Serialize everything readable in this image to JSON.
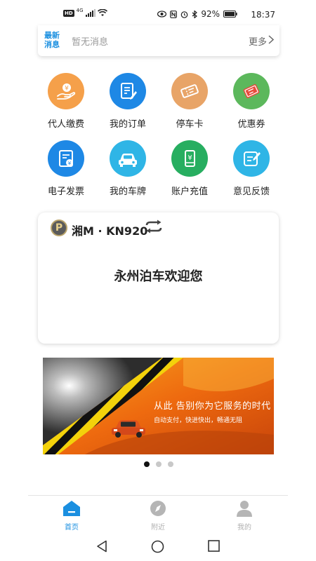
{
  "status_bar": {
    "network": "4G",
    "hd": "HD",
    "battery": "92%",
    "time": "18:37"
  },
  "news": {
    "tag": "最新消息",
    "message": "暂无消息",
    "more": "更多"
  },
  "grid": {
    "items": [
      {
        "label": "代人缴费",
        "icon": "hand-coin-icon",
        "color": "#f5a04a"
      },
      {
        "label": "我的订单",
        "icon": "order-doc-icon",
        "color": "#1e88e5"
      },
      {
        "label": "停车卡",
        "icon": "ticket-icon",
        "color": "#e8a467"
      },
      {
        "label": "优惠券",
        "icon": "coupon-icon",
        "color": "#5cb85c"
      },
      {
        "label": "电子发票",
        "icon": "invoice-icon",
        "color": "#1e88e5"
      },
      {
        "label": "我的车牌",
        "icon": "car-icon",
        "color": "#2fb5e6"
      },
      {
        "label": "账户充值",
        "icon": "phone-yen-icon",
        "color": "#27ae60"
      },
      {
        "label": "意见反馈",
        "icon": "feedback-icon",
        "color": "#2fb5e6"
      }
    ]
  },
  "card": {
    "badge": "P",
    "plate": "湘M · KN920",
    "welcome": "永州泊车欢迎您"
  },
  "banner": {
    "headline": "从此 告别你为它服务的时代",
    "subline": "自动支付，快进快出，畅通无阻"
  },
  "carousel": {
    "count": 3,
    "active": 0
  },
  "tabs": [
    {
      "label": "首页",
      "icon": "home-icon",
      "active": true
    },
    {
      "label": "附近",
      "icon": "compass-icon",
      "active": false
    },
    {
      "label": "我的",
      "icon": "user-icon",
      "active": false
    }
  ],
  "colors": {
    "accent": "#1a8fe0",
    "inactive": "#b0b0b0"
  }
}
